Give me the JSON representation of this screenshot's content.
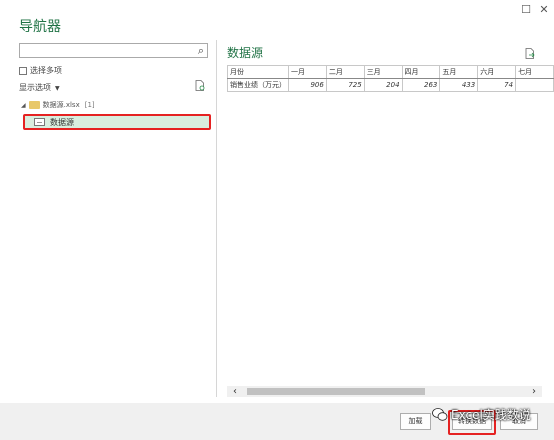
{
  "window": {
    "restore_glyph": "☐",
    "close_glyph": "✕"
  },
  "title": "导航器",
  "left": {
    "search": {
      "value": "",
      "placeholder": ""
    },
    "multi_select_label": "选择多项",
    "display_options_label": "显示选项",
    "tree": {
      "file_name": "数据源.xlsx",
      "file_count": "[1]",
      "sheet_name": "数据源"
    }
  },
  "preview": {
    "title": "数据源",
    "columns": [
      "月份",
      "一月",
      "二月",
      "三月",
      "四月",
      "五月",
      "六月",
      "七月"
    ],
    "rows": [
      [
        "销售业绩（万元）",
        "906",
        "725",
        "204",
        "263",
        "433",
        "74",
        ""
      ]
    ]
  },
  "footer": {
    "load_label": "加载",
    "transform_label": "转换数据",
    "cancel_label": "取消"
  },
  "watermark": "Excel实践数说",
  "colors": {
    "accent": "#217346",
    "highlight_red": "#e52222",
    "selected_bg": "#d9eedf"
  }
}
